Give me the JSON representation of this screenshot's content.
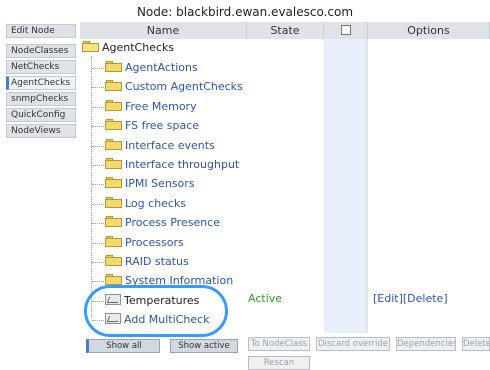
{
  "window": {
    "title": "Node: blackbird.ewan.evalesco.com"
  },
  "leftnav": {
    "items": [
      {
        "label": "Edit Node",
        "active": false
      },
      {
        "label": "NodeClasses",
        "active": false
      },
      {
        "label": "NetChecks",
        "active": false
      },
      {
        "label": "AgentChecks",
        "active": true
      },
      {
        "label": "snmpChecks",
        "active": false
      },
      {
        "label": "QuickConfig",
        "active": false
      },
      {
        "label": "NodeViews",
        "active": false
      }
    ]
  },
  "table": {
    "headers": {
      "name": "Name",
      "state": "State",
      "options": "Options"
    }
  },
  "tree": {
    "root": {
      "label": "AgentChecks",
      "icon": "folder-open-icon"
    },
    "items": [
      {
        "label": "AgentActions",
        "type": "folder",
        "style": "link"
      },
      {
        "label": "Custom AgentChecks",
        "type": "folder",
        "style": "link"
      },
      {
        "label": "Free Memory",
        "type": "folder",
        "style": "link"
      },
      {
        "label": "FS free space",
        "type": "folder",
        "style": "link"
      },
      {
        "label": "Interface events",
        "type": "folder",
        "style": "link"
      },
      {
        "label": "Interface throughput",
        "type": "folder",
        "style": "link"
      },
      {
        "label": "IPMI Sensors",
        "type": "folder",
        "style": "link"
      },
      {
        "label": "Log checks",
        "type": "folder",
        "style": "link"
      },
      {
        "label": "Process Presence",
        "type": "folder",
        "style": "link"
      },
      {
        "label": "Processors",
        "type": "folder",
        "style": "link"
      },
      {
        "label": "RAID status",
        "type": "folder",
        "style": "link"
      },
      {
        "label": "System Information",
        "type": "folder",
        "style": "link"
      },
      {
        "label": "Temperatures",
        "type": "check",
        "style": "plain"
      },
      {
        "label": "Add MultiCheck",
        "type": "check",
        "style": "link"
      }
    ]
  },
  "selected_row": {
    "state": "Active",
    "options": "[Edit][Delete]"
  },
  "bottom": {
    "show_all": "Show all",
    "show_active": "Show active",
    "to_nodeclass": "To NodeClass",
    "discard_override": "Discard override",
    "dependencies": "Dependencies",
    "delete": "Delete",
    "rescan": "Rescan"
  },
  "colors": {
    "accent": "#1e90ff",
    "link": "#2b55b0",
    "active": "#2f9e2f",
    "column_highlight": "#e8f1fb"
  }
}
